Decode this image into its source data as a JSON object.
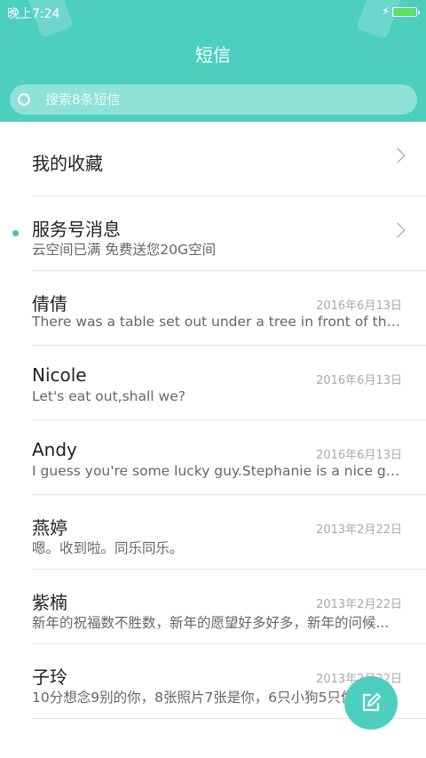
{
  "status_bar": {
    "time": "晚上7:24",
    "charging_icon": "bolt-icon",
    "battery_icon": "battery-icon"
  },
  "header": {
    "title": "短信"
  },
  "search": {
    "placeholder": "搜索8条短信",
    "icon": "search-icon"
  },
  "favorites": {
    "label": "我的收藏"
  },
  "service": {
    "name": "服务号消息",
    "snippet": "云空间已满 免费送您20G空间"
  },
  "conversations": [
    {
      "name": "倩倩",
      "snippet": "There was a table set out under a tree in front of the ho...",
      "date": "2016年6月13日"
    },
    {
      "name": "Nicole",
      "snippet": "Let's eat out,shall we?",
      "date": "2016年6月13日"
    },
    {
      "name": "Andy",
      "snippet": "I guess you're some lucky guy.Stephanie is a nice girl.",
      "date": "2016年6月13日"
    },
    {
      "name": "燕婷",
      "snippet": "嗯。收到啦。同乐同乐。",
      "date": "2013年2月22日"
    },
    {
      "name": "紫楠",
      "snippet": "新年的祝福数不胜数，新年的愿望好多好多，新年的问候...",
      "date": "2013年2月22日"
    },
    {
      "name": "子玲",
      "snippet": "10分想念9别的你，8张照片7张是你，6只小狗5只像",
      "date": "2013年2月22日"
    }
  ],
  "fab": {
    "icon": "compose-icon"
  },
  "colors": {
    "accent": "#4ccfbf",
    "battery": "#5fe54a"
  }
}
